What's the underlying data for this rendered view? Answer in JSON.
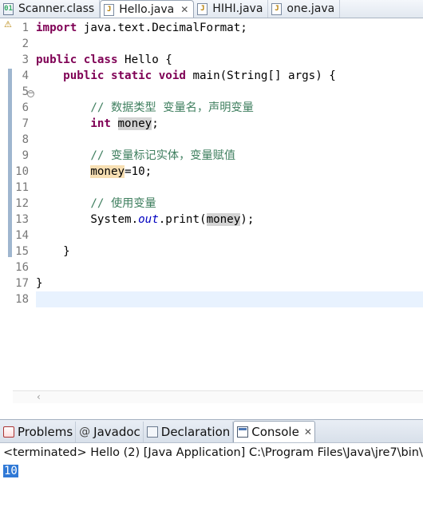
{
  "editor_tabs": [
    {
      "label": "Scanner.class",
      "icon": "class-file-icon",
      "active": false
    },
    {
      "label": "Hello.java",
      "icon": "java-file-icon",
      "active": true,
      "close": "✕"
    },
    {
      "label": "HIHI.java",
      "icon": "java-file-icon",
      "active": false
    },
    {
      "label": "one.java",
      "icon": "java-file-icon",
      "active": false
    }
  ],
  "line_numbers": [
    "1",
    "2",
    "3",
    "4",
    "5",
    "6",
    "7",
    "8",
    "9",
    "10",
    "11",
    "12",
    "13",
    "14",
    "15",
    "16",
    "17",
    "18"
  ],
  "code": {
    "l1_kw": "import",
    "l1_rest": " java.text.DecimalFormat;",
    "l3_kw": "public class",
    "l3_rest": " Hello {",
    "l4_kw": "public static void",
    "l4_rest": " main(String[] args) {",
    "l6_comment": "// 数据类型 变量名，声明变量",
    "l7_kw": "int",
    "l7_var": "money",
    "l7_end": ";",
    "l9_comment": "// 变量标记实体，变量赋值",
    "l10_var": "money",
    "l10_rest": "=10;",
    "l12_comment": "// 使用变量",
    "l13_a": "System.",
    "l13_field": "out",
    "l13_b": ".print(",
    "l13_var": "money",
    "l13_c": ");",
    "l15": "}",
    "l17": "}"
  },
  "panel_tabs": [
    {
      "label": "Problems",
      "icon": "problems-icon"
    },
    {
      "label": "Javadoc",
      "icon": "javadoc-icon",
      "glyph": "@"
    },
    {
      "label": "Declaration",
      "icon": "declaration-icon"
    },
    {
      "label": "Console",
      "icon": "console-icon",
      "active": true,
      "close": "✕"
    }
  ],
  "console": {
    "status": "<terminated> Hello (2) [Java Application] C:\\Program Files\\Java\\jre7\\bin\\",
    "output": "10"
  },
  "colors": {
    "keyword": "#7f0055",
    "comment": "#3f7f5f",
    "static_field": "#0000c0",
    "current_line": "#e8f2fe",
    "selection": "#3079d6"
  }
}
